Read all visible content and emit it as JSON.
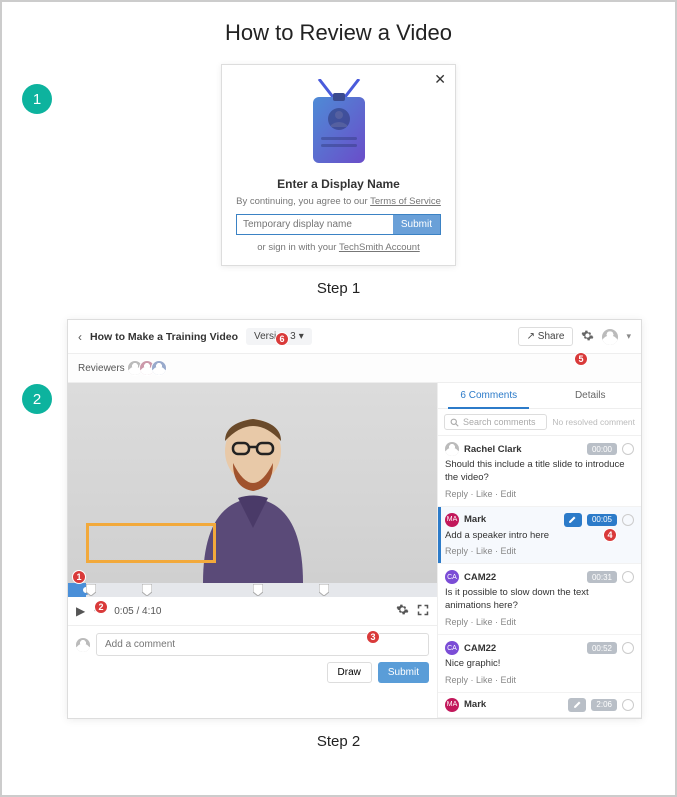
{
  "page_title": "How to Review a Video",
  "step_labels": {
    "s1": "Step 1",
    "s2": "Step 2"
  },
  "step_badges": {
    "one": "1",
    "two": "2"
  },
  "modal": {
    "close": "✕",
    "heading": "Enter a Display Name",
    "tos_prefix": "By continuing, you agree to our ",
    "tos_link": "Terms of Service",
    "placeholder": "Temporary display name",
    "submit": "Submit",
    "signin_prefix": "or sign in with your ",
    "signin_link": "TechSmith Account"
  },
  "app": {
    "back": "‹",
    "title": "How to Make a Training Video",
    "version": "Version 3",
    "version_caret": "▾",
    "share": "↗ Share",
    "avatar_caret": "▾",
    "gear": "cog",
    "reviewers_label": "Reviewers",
    "time": "0:05 / 4:10",
    "comment_placeholder": "Add a comment",
    "draw": "Draw",
    "submit": "Submit",
    "markers_pct": [
      5,
      20,
      50,
      68
    ],
    "tabs": {
      "comments": "6 Comments",
      "details": "Details"
    },
    "search_placeholder": "Search comments",
    "no_resolved": "No resolved comment",
    "comments": [
      {
        "avatar": "generic",
        "name": "Rachel Clark",
        "ts": "00:00",
        "text": "Should this include a title slide to introduce the video?"
      },
      {
        "avatar": "MA",
        "name": "Mark",
        "ts": "00:05",
        "pencil": true,
        "text": "Add a speaker intro here",
        "selected": true
      },
      {
        "avatar": "CA",
        "name": "CAM22",
        "ts": "00:31",
        "text": "Is it possible to slow down the text animations here?"
      },
      {
        "avatar": "CA",
        "name": "CAM22",
        "ts": "00:52",
        "text": "Nice graphic!"
      },
      {
        "avatar": "MA",
        "name": "Mark",
        "ts": "2:06",
        "pencil": true,
        "mini": true
      }
    ],
    "actions": {
      "reply": "Reply",
      "like": "Like",
      "edit": "Edit",
      "sep": " · "
    },
    "avatar_labels": {
      "ma": "MA",
      "ca": "CA"
    }
  },
  "dots": {
    "d1": "1",
    "d2": "2",
    "d3": "3",
    "d4": "4",
    "d5": "5",
    "d6": "6"
  }
}
